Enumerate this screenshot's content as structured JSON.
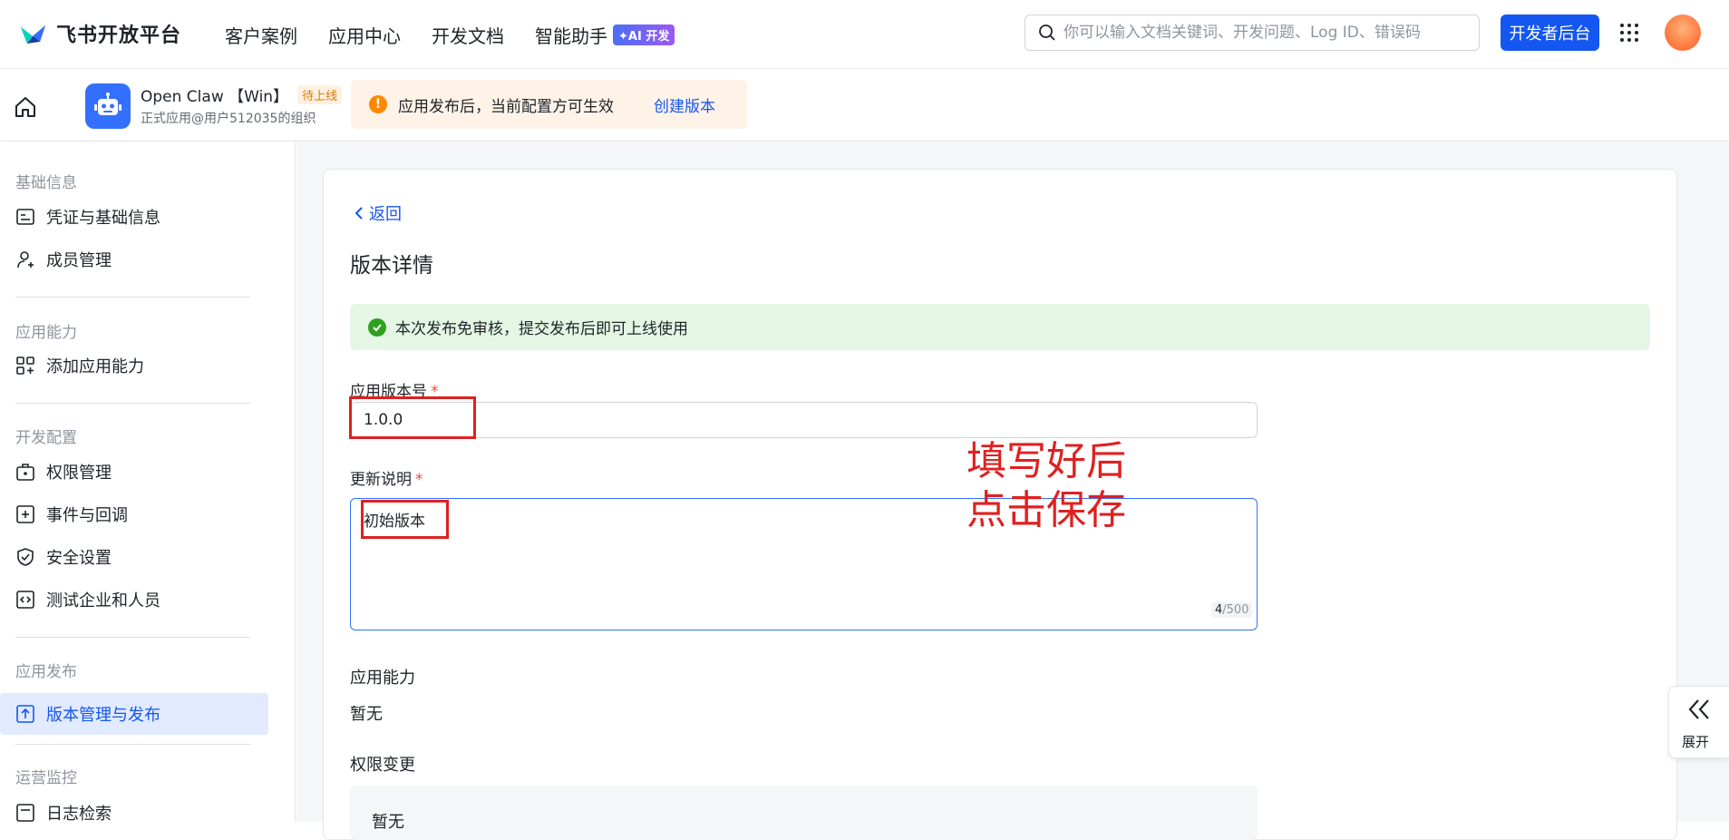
{
  "header": {
    "brand": "飞书开放平台",
    "nav": [
      "客户案例",
      "应用中心",
      "开发文档",
      "智能助手"
    ],
    "ai_badge": "✦AI 开发",
    "search_placeholder": "你可以输入文档关键词、开发问题、Log ID、错误码",
    "dev_console": "开发者后台"
  },
  "app_bar": {
    "app_name": "Open Claw 【Win】",
    "status": "待上线",
    "org": "正式应用@用户512035的组织",
    "notice": "应用发布后，当前配置方可生效",
    "notice_link": "创建版本"
  },
  "sidebar": {
    "groups": [
      {
        "title": "基础信息",
        "items": [
          "凭证与基础信息",
          "成员管理"
        ]
      },
      {
        "title": "应用能力",
        "items": [
          "添加应用能力"
        ]
      },
      {
        "title": "开发配置",
        "items": [
          "权限管理",
          "事件与回调",
          "安全设置",
          "测试企业和人员"
        ]
      },
      {
        "title": "应用发布",
        "items": [
          "版本管理与发布"
        ]
      },
      {
        "title": "运营监控",
        "items": [
          "日志检索"
        ]
      }
    ]
  },
  "main": {
    "back": "返回",
    "title": "版本详情",
    "success_msg": "本次发布免审核，提交发布后即可上线使用",
    "version_label": "应用版本号",
    "version_value": "1.0.0",
    "desc_label": "更新说明",
    "desc_value": "初始版本",
    "counter_current": "4",
    "counter_max": "/500",
    "capability_label": "应用能力",
    "capability_value": "暂无",
    "perm_label": "权限变更",
    "perm_value": "暂无"
  },
  "annotation": {
    "line1": "填写好后",
    "line2": "点击保存"
  },
  "expand": "展开",
  "colors": {
    "primary": "#1456f0",
    "annotation": "#e02020",
    "success_bg": "#e4f7e4",
    "notice_bg": "#fff3e8"
  }
}
